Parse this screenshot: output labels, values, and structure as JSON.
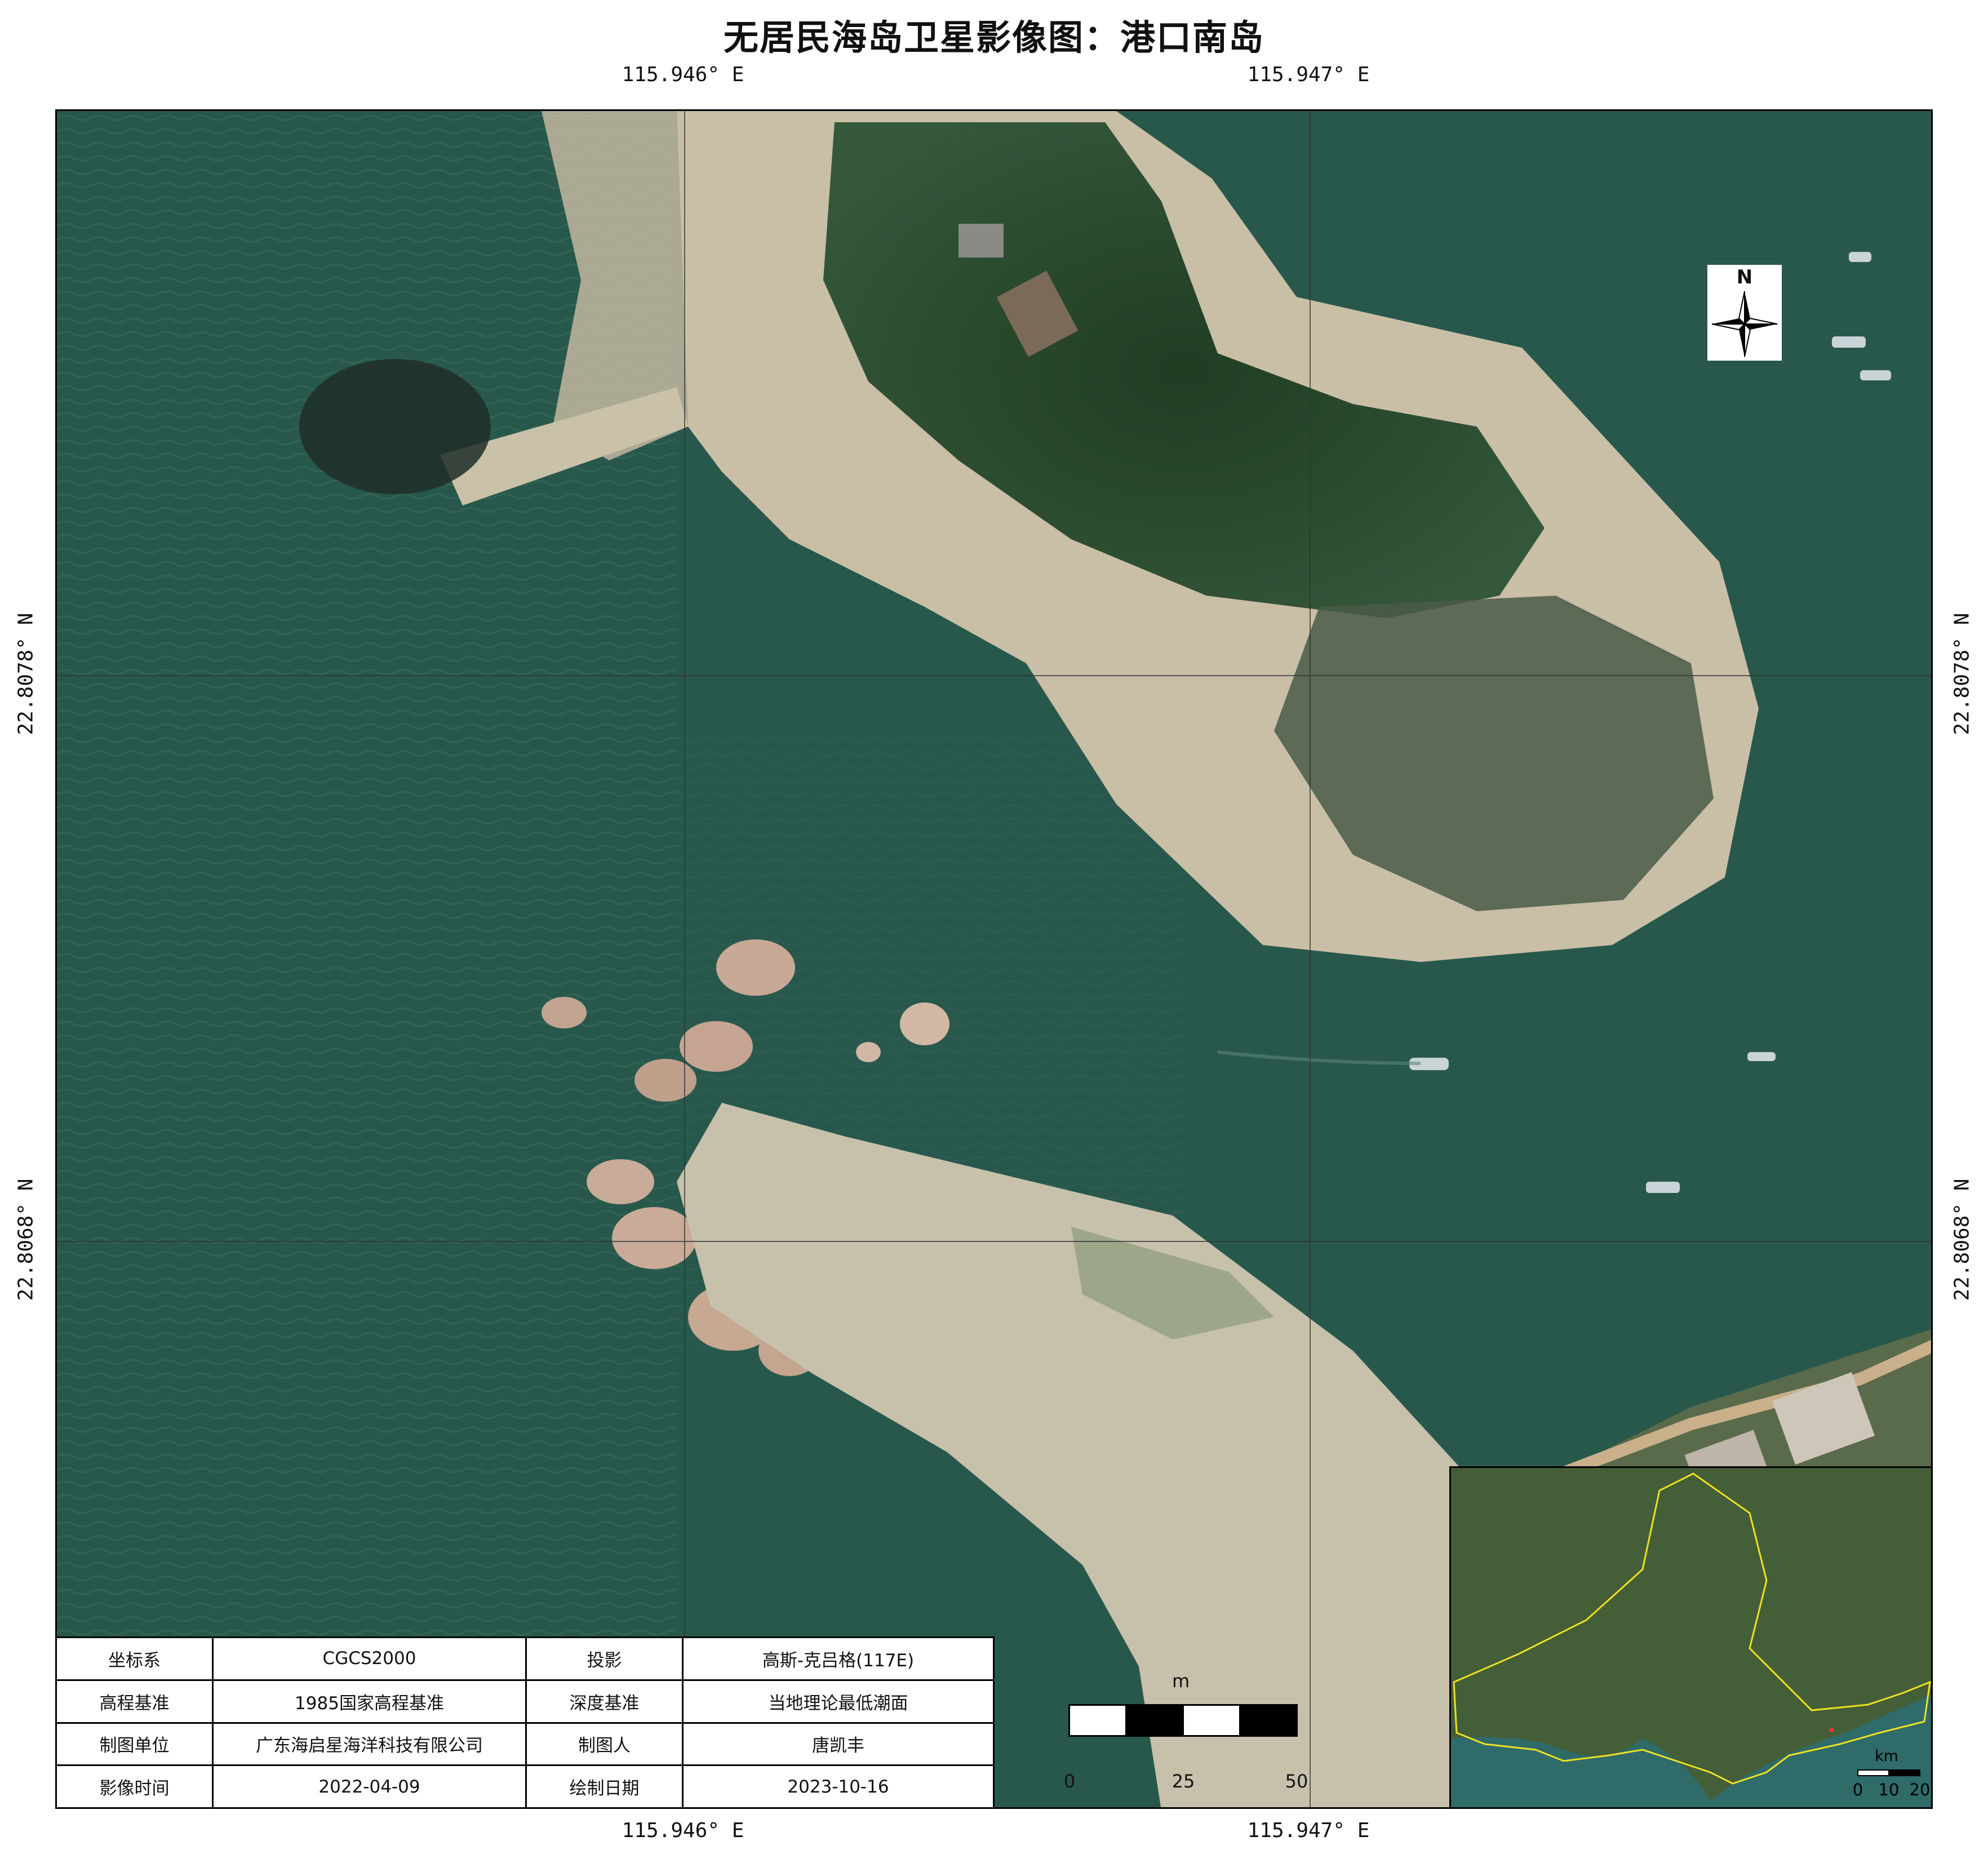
{
  "title": "无居民海岛卫星影像图：港口南岛",
  "coords": {
    "lon_left": "115.946° E",
    "lon_right": "115.947° E",
    "lat_upper": "22.8078° N",
    "lat_lower": "22.8068° N"
  },
  "north_arrow": {
    "label": "N"
  },
  "info_table": {
    "coord_system_label": "坐标系",
    "coord_system_value": "CGCS2000",
    "projection_label": "投影",
    "projection_value": "高斯-克吕格(117E)",
    "elevation_datum_label": "高程基准",
    "elevation_datum_value": "1985国家高程基准",
    "depth_datum_label": "深度基准",
    "depth_datum_value": "当地理论最低潮面",
    "mapping_unit_label": "制图单位",
    "mapping_unit_value": "广东海启星海洋科技有限公司",
    "cartographer_label": "制图人",
    "cartographer_value": "唐凯丰",
    "image_date_label": "影像时间",
    "image_date_value": "2022-04-09",
    "draw_date_label": "绘制日期",
    "draw_date_value": "2023-10-16"
  },
  "scale_bar": {
    "unit": "m",
    "ticks": [
      "0",
      "25",
      "50"
    ]
  },
  "inset_map": {
    "scale_unit": "km",
    "ticks": [
      "0",
      "10",
      "20"
    ]
  },
  "colors": {
    "sea": "#28584c",
    "sand": "#c9bfa6",
    "vegetation": "#2b4a2e",
    "rock": "#c8a996",
    "boundary": "#f0e020"
  }
}
